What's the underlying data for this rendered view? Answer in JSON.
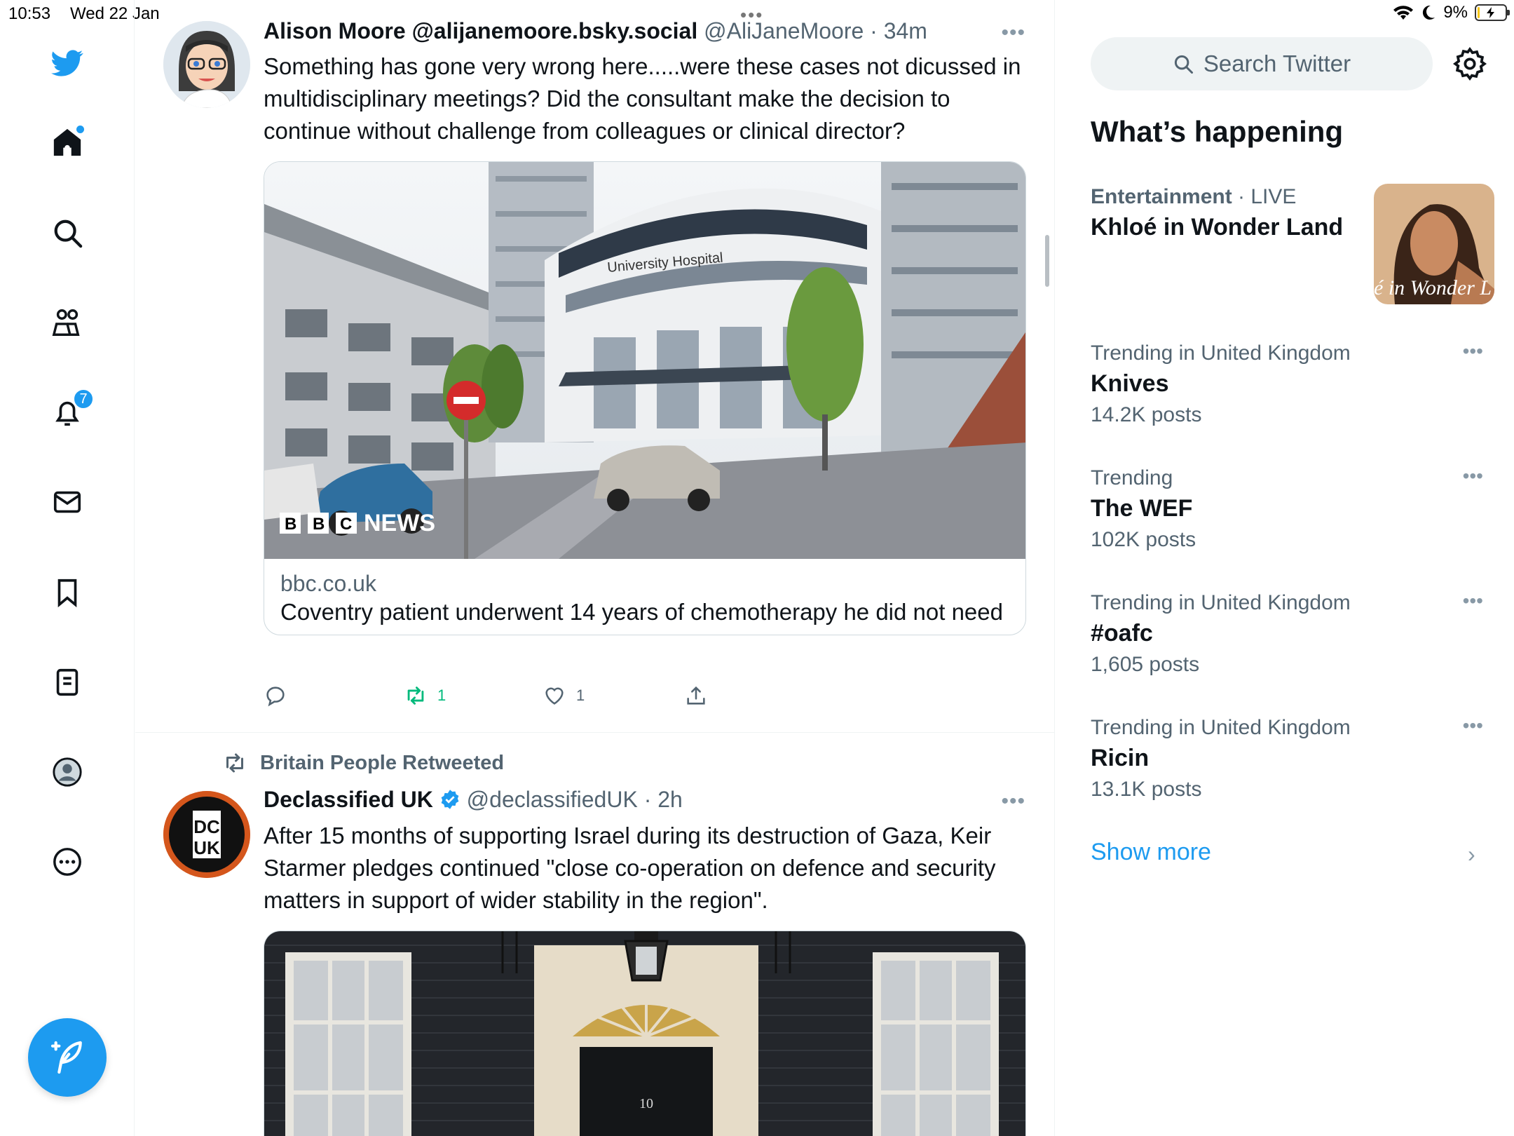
{
  "status_bar": {
    "time": "10:53",
    "date": "Wed 22 Jan",
    "battery": "9%",
    "battery_level": 0.09
  },
  "nav": {
    "icons": [
      "twitter-bird-icon",
      "home-icon",
      "search-icon",
      "communities-icon",
      "notifications-icon",
      "messages-icon",
      "bookmarks-icon",
      "lists-icon",
      "profile-icon",
      "more-icon"
    ],
    "notifications_badge": "7",
    "accent": "#1d9bf0"
  },
  "feed": {
    "tweet1": {
      "name": "Alison Moore @alijanemoore.bsky.social",
      "handle": "@AliJaneMoore",
      "time": "· 34m",
      "text": "Something has gone very wrong here.....were these cases not dicussed in multidisciplinary meetings? Did the consultant make the decision to continue without challenge from colleagues or clinical director?",
      "card": {
        "image_sign": "University Hospital",
        "image_logo": "BBC NEWS",
        "domain": "bbc.co.uk",
        "title": "Coventry patient underwent 14 years of chemotherapy he did not need"
      },
      "actions": {
        "replies": "",
        "retweets": "1",
        "likes": "1"
      }
    },
    "tweet2": {
      "retweeted_by": "Britain People Retweeted",
      "avatar_text": "DC UK",
      "name": "Declassified UK",
      "handle": "@declassifiedUK",
      "time": "· 2h",
      "text": "After 15 months of supporting Israel during its destruction of Gaza, Keir Starmer pledges continued \"close co-operation on defence and security matters in support of wider stability in the region\".",
      "image_door_number": "10"
    }
  },
  "sidebar": {
    "search_placeholder": "Search Twitter",
    "title": "What’s happening",
    "trends": [
      {
        "category": "Entertainment",
        "live": "· LIVE",
        "name": "Khloé in Wonder Land",
        "thumb_text": "é in Wonder L"
      },
      {
        "category": "Trending in United Kingdom",
        "name": "Knives",
        "count": "14.2K posts"
      },
      {
        "category": "Trending",
        "name": "The WEF",
        "count": "102K posts"
      },
      {
        "category": "Trending in United Kingdom",
        "name": "#oafc",
        "count": "1,605 posts"
      },
      {
        "category": "Trending in United Kingdom",
        "name": "Ricin",
        "count": "13.1K posts"
      }
    ],
    "show_more": "Show more"
  }
}
